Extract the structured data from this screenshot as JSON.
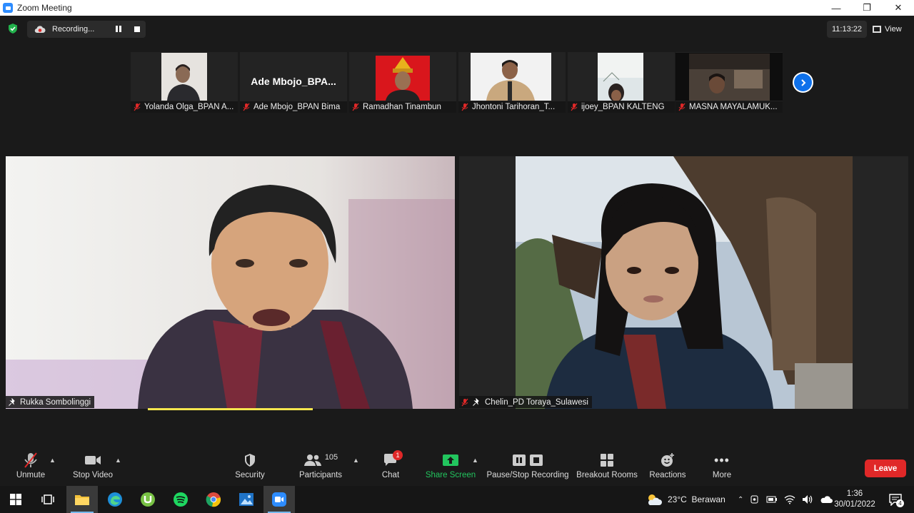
{
  "window": {
    "title": "Zoom Meeting"
  },
  "topbar": {
    "recording_label": "Recording...",
    "meeting_time": "11:13:22",
    "view_label": "View"
  },
  "thumbnails": [
    {
      "name": "Yolanda Olga_BPAN A..."
    },
    {
      "name": "Ade Mbojo_BPAN Bima",
      "display": "Ade  Mbojo_BPA..."
    },
    {
      "name": "Ramadhan Tinambun"
    },
    {
      "name": "Jhontoni Tarihoran_T..."
    },
    {
      "name": "ijoey_BPAN KALTENG"
    },
    {
      "name": "MASNA MAYALAMUK..."
    }
  ],
  "main_videos": [
    {
      "name": "Rukka Sombolinggi"
    },
    {
      "name": "Chelin_PD Toraya_Sulawesi"
    }
  ],
  "toolbar": {
    "unmute": "Unmute",
    "stop_video": "Stop Video",
    "security": "Security",
    "participants": "Participants",
    "participant_count": "105",
    "chat": "Chat",
    "chat_badge": "1",
    "share_screen": "Share Screen",
    "pause_stop_recording": "Pause/Stop Recording",
    "breakout_rooms": "Breakout Rooms",
    "reactions": "Reactions",
    "more": "More",
    "leave": "Leave"
  },
  "taskbar": {
    "weather": "23°C  Berawan",
    "time": "1:36",
    "date": "30/01/2022",
    "notification_count": "4"
  },
  "colors": {
    "accent_blue": "#0e71eb",
    "leave_red": "#e02828",
    "share_green": "#22c55e",
    "speaker_yellow": "#f7e64e"
  }
}
